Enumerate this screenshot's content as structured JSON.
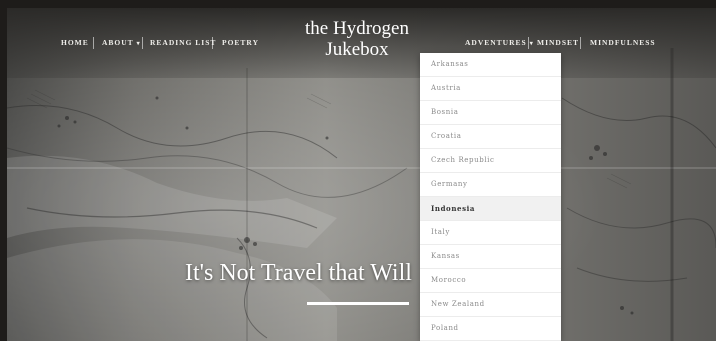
{
  "site": {
    "logo_line1": "the Hydrogen",
    "logo_line2": "Jukebox"
  },
  "nav": {
    "home": "HOME",
    "about": "ABOUT",
    "reading_list": "READING LIST",
    "poetry": "POETRY",
    "adventures": "ADVENTURES",
    "mindset": "MINDSET",
    "mindfulness": "MINDFULNESS"
  },
  "dropdown": {
    "items": [
      "Arkansas",
      "Austria",
      "Bosnia",
      "Croatia",
      "Czech Republic",
      "Germany",
      "Indonesia",
      "Italy",
      "Kansas",
      "Morocco",
      "New Zealand",
      "Poland"
    ],
    "active_item": "Indonesia"
  },
  "hero": {
    "headline": "It's Not Travel that Will"
  },
  "colors": {
    "nav_text": "#efeeea",
    "dropdown_bg": "#ffffff",
    "dropdown_text": "#8a8a8a",
    "dropdown_active_bg": "#f1f1f1"
  }
}
